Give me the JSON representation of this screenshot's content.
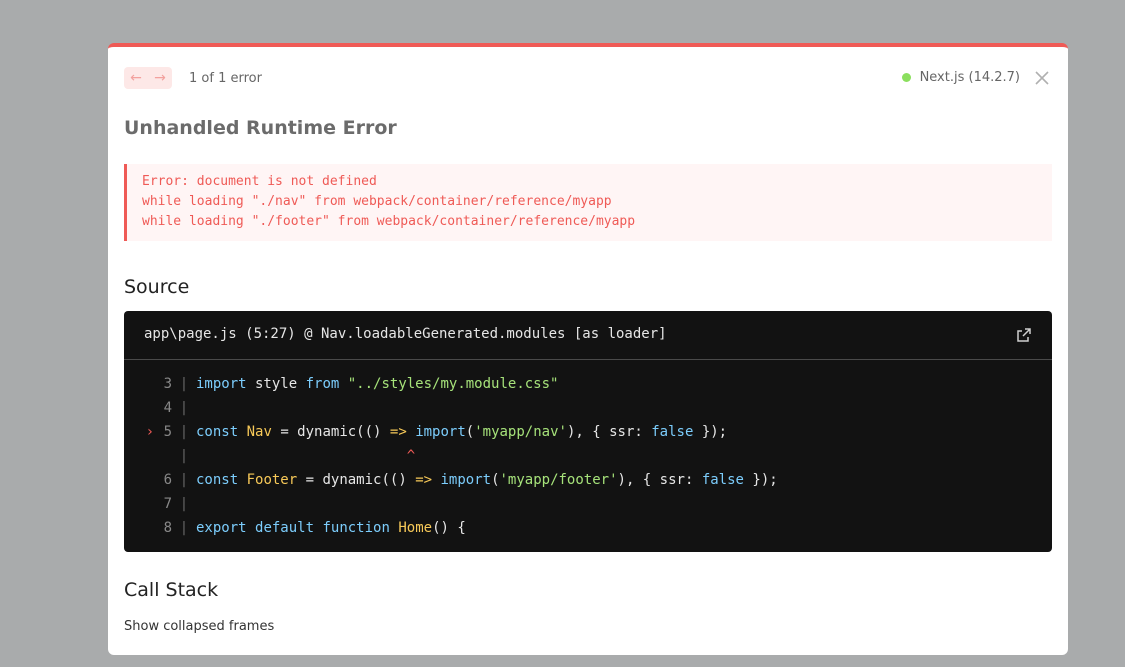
{
  "header": {
    "prev_icon": "arrow-left-icon",
    "next_icon": "arrow-right-icon",
    "error_count": "1 of 1 error",
    "version_label": "Next.js (14.2.7)",
    "close_icon": "close-icon"
  },
  "heading": "Unhandled Runtime Error",
  "error_message": "Error: document is not defined\nwhile loading \"./nav\" from webpack/container/reference/myapp\nwhile loading \"./footer\" from webpack/container/reference/myapp",
  "source": {
    "title": "Source",
    "file": "app\\page.js (5:27) @ Nav.loadableGenerated.modules [as loader]",
    "open_icon": "external-link-icon",
    "lines": [
      {
        "marker": "",
        "num": "3",
        "tokens": [
          [
            "kw",
            "import"
          ],
          [
            "p",
            " style "
          ],
          [
            "kw",
            "from"
          ],
          [
            "p",
            " "
          ],
          [
            "str",
            "\"../styles/my.module.css\""
          ]
        ]
      },
      {
        "marker": "",
        "num": "4",
        "tokens": []
      },
      {
        "marker": ">",
        "num": "5",
        "tokens": [
          [
            "kw",
            "const"
          ],
          [
            "p",
            " "
          ],
          [
            "fn",
            "Nav"
          ],
          [
            "p",
            " = dynamic(() "
          ],
          [
            "op",
            "=>"
          ],
          [
            "p",
            " "
          ],
          [
            "kw",
            "import"
          ],
          [
            "p",
            "("
          ],
          [
            "str",
            "'myapp/nav'"
          ],
          [
            "p",
            "), { ssr: "
          ],
          [
            "kw",
            "false"
          ],
          [
            "p",
            " });"
          ]
        ]
      },
      {
        "marker": "",
        "num": "",
        "tokens": [
          [
            "caret",
            "                         ^"
          ]
        ]
      },
      {
        "marker": "",
        "num": "6",
        "tokens": [
          [
            "kw",
            "const"
          ],
          [
            "p",
            " "
          ],
          [
            "fn",
            "Footer"
          ],
          [
            "p",
            " = dynamic(() "
          ],
          [
            "op",
            "=>"
          ],
          [
            "p",
            " "
          ],
          [
            "kw",
            "import"
          ],
          [
            "p",
            "("
          ],
          [
            "str",
            "'myapp/footer'"
          ],
          [
            "p",
            "), { ssr: "
          ],
          [
            "kw",
            "false"
          ],
          [
            "p",
            " });"
          ]
        ]
      },
      {
        "marker": "",
        "num": "7",
        "tokens": []
      },
      {
        "marker": "",
        "num": "8",
        "tokens": [
          [
            "kw",
            "export"
          ],
          [
            "p",
            " "
          ],
          [
            "kw",
            "default"
          ],
          [
            "p",
            " "
          ],
          [
            "kw",
            "function"
          ],
          [
            "p",
            " "
          ],
          [
            "fn",
            "Home"
          ],
          [
            "p",
            "() {"
          ]
        ]
      }
    ]
  },
  "call_stack": {
    "title": "Call Stack",
    "toggle_label": "Show collapsed frames"
  },
  "colors": {
    "accent": "#ef5a56",
    "status_dot": "#8bdf5e"
  }
}
